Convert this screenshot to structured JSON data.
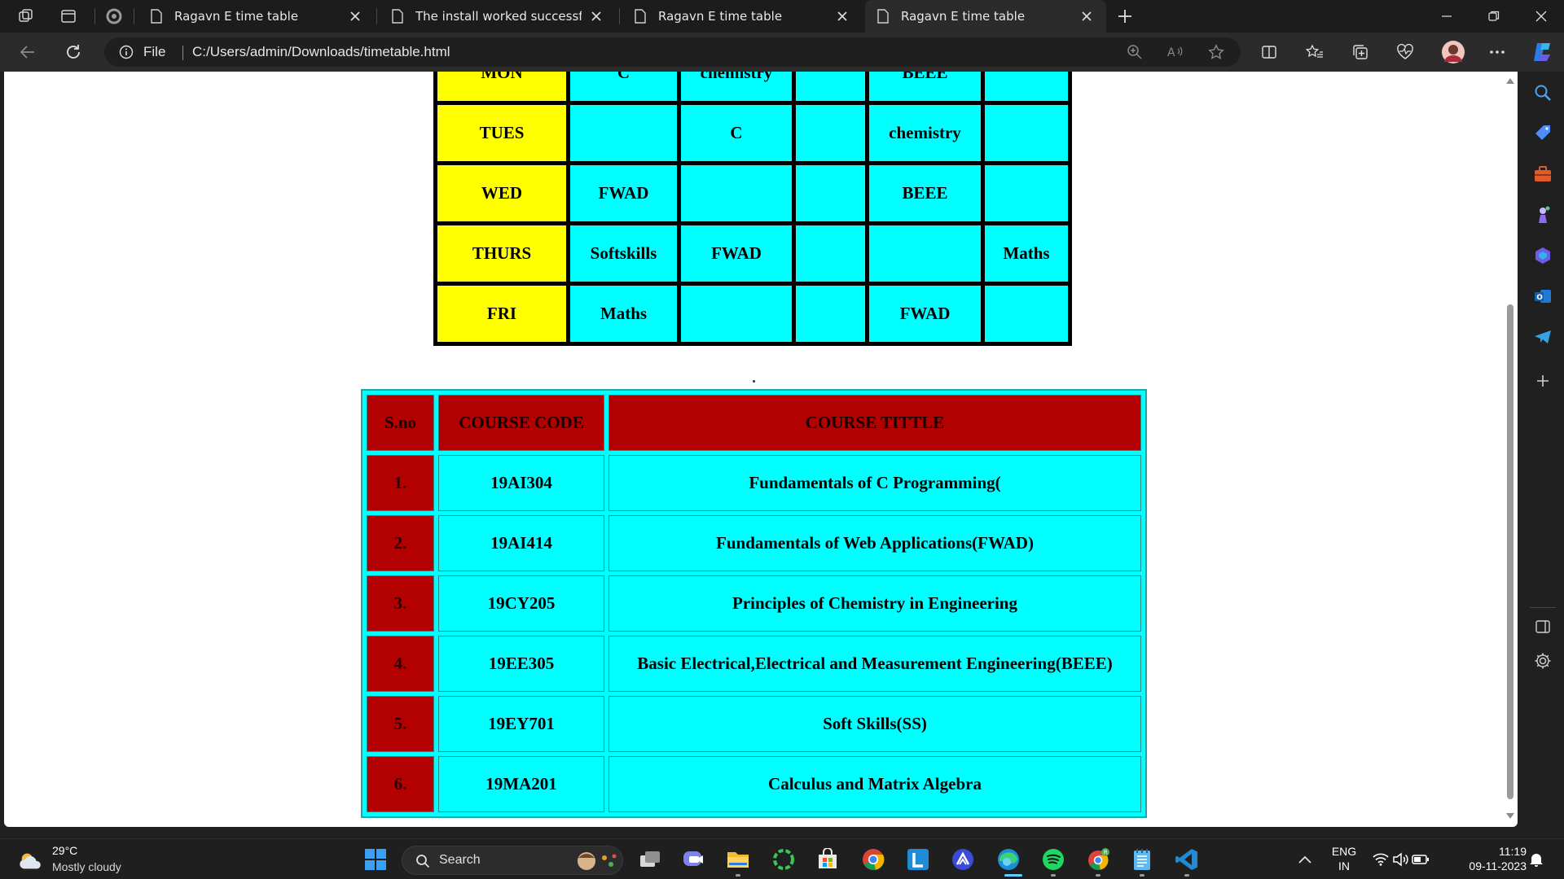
{
  "browser": {
    "tabs": [
      {
        "title": "Ragavn E time table",
        "active": false
      },
      {
        "title": "The install worked successfully! C",
        "active": false
      },
      {
        "title": "Ragavn E time table",
        "active": false
      },
      {
        "title": "Ragavn E time table",
        "active": true
      }
    ],
    "address": {
      "scheme_label": "File",
      "url": "C:/Users/admin/Downloads/timetable.html"
    }
  },
  "timetable": {
    "rows": [
      {
        "day": "MON",
        "cells": [
          "C",
          "chemistry",
          "",
          "BEEE",
          ""
        ]
      },
      {
        "day": "TUES",
        "cells": [
          "",
          "C",
          "",
          "chemistry",
          ""
        ]
      },
      {
        "day": "WED",
        "cells": [
          "FWAD",
          "",
          "",
          "BEEE",
          ""
        ]
      },
      {
        "day": "THURS",
        "cells": [
          "Softskills",
          "FWAD",
          "",
          "",
          "Maths"
        ]
      },
      {
        "day": "FRI",
        "cells": [
          "Maths",
          "",
          "",
          "FWAD",
          ""
        ]
      }
    ]
  },
  "courses": {
    "headers": {
      "sno": "S.no",
      "code": "COURSE CODE",
      "title": "COURSE TITTLE"
    },
    "rows": [
      {
        "sno": "1.",
        "code": "19AI304",
        "title": "Fundamentals of C Programming("
      },
      {
        "sno": "2.",
        "code": "19AI414",
        "title": "Fundamentals of Web Applications(FWAD)"
      },
      {
        "sno": "3.",
        "code": "19CY205",
        "title": "Principles of Chemistry in Engineering"
      },
      {
        "sno": "4.",
        "code": "19EE305",
        "title": "Basic Electrical,Electrical and Measurement Engineering(BEEE)"
      },
      {
        "sno": "5.",
        "code": "19EY701",
        "title": "Soft Skills(SS)"
      },
      {
        "sno": "6.",
        "code": "19MA201",
        "title": "Calculus and Matrix Algebra"
      }
    ]
  },
  "taskbar": {
    "weather": {
      "temp": "29°C",
      "desc": "Mostly cloudy"
    },
    "search_placeholder": "Search",
    "lang_top": "ENG",
    "lang_bottom": "IN",
    "time": "11:19",
    "date": "09-11-2023"
  },
  "colors": {
    "day_cell": "#ffff00",
    "period_cell": "#00ffff",
    "header_cell": "#b30000"
  }
}
